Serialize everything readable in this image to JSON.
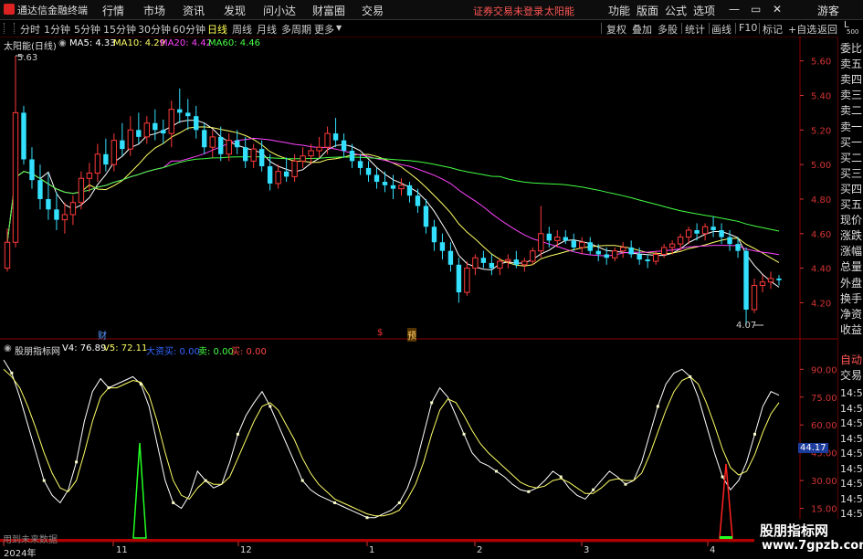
{
  "app": {
    "logo_label": "通达信金融终端",
    "warning": "证券交易未登录",
    "stock_title": "太阳能",
    "guest_label": "游客"
  },
  "menu": {
    "items": [
      "行情",
      "市场",
      "资讯",
      "发现",
      "问小达",
      "财富圈",
      "交易"
    ],
    "right_items": [
      "功能",
      "版面",
      "公式",
      "选项"
    ]
  },
  "toolbar": {
    "periods": [
      "分时",
      "1分钟",
      "5分钟",
      "15分钟",
      "30分钟",
      "60分钟",
      "日线",
      "周线",
      "月线",
      "多周期",
      "更多"
    ],
    "active": "日线",
    "right": [
      "复权",
      "叠加",
      "多股",
      "统计",
      "画线",
      "F10",
      "标记",
      "+自选",
      "返回"
    ]
  },
  "main_chart": {
    "title": "太阳能(日线)",
    "ma": [
      {
        "label": "MA5: 4.33",
        "color": "#ffffff"
      },
      {
        "label": "MA10: 4.29",
        "color": "#ffff66"
      },
      {
        "label": "MA20: 4.42",
        "color": "#ff44ff"
      },
      {
        "label": "MA60: 4.46",
        "color": "#44ff44"
      }
    ],
    "high_label": "5.63",
    "low_label": "4.07",
    "markers": [
      {
        "text": "财",
        "color": "#5599ff"
      },
      {
        "text": "$",
        "color": "#ff3333"
      },
      {
        "text": "预",
        "color": "#ffcc66"
      }
    ]
  },
  "sub_chart": {
    "title": "股朋指标网",
    "v4": "V4: 76.89",
    "v5": "V5: 72.11",
    "big_buy": "大资买: 0.00",
    "sell": "卖: 0.00",
    "buy": "买: 0.00",
    "current_value": "44.17",
    "footer_note": "用到未来数据"
  },
  "side_panel": {
    "corner": [
      "L",
      "500"
    ],
    "top_items": [
      "委比",
      "卖五",
      "卖四",
      "卖三",
      "卖二",
      "卖一",
      "买一",
      "买二",
      "买三",
      "买四",
      "买五",
      "现价",
      "涨跌",
      "涨幅",
      "总量",
      "外盘",
      "换手",
      "净资",
      "收益"
    ],
    "bottom_items": [
      "自动",
      "交易"
    ],
    "times": [
      "14:56",
      "14:56",
      "14:56",
      "14:56",
      "14:56",
      "14:56",
      "14:56",
      "14:56",
      "14:56",
      "14:56"
    ]
  },
  "x_axis": {
    "labels": [
      "2024年",
      "11",
      "12",
      "1",
      "2",
      "3",
      "4"
    ]
  },
  "watermark": {
    "line1": "股朋指标网",
    "line2": "www.7gpzb.com"
  },
  "colors": {
    "up": "#ff3a3a",
    "down": "#33e0ff",
    "axis": "#d33333"
  },
  "chart_data": [
    {
      "type": "candlestick",
      "title": "太阳能(日线)",
      "ylim": [
        4.07,
        5.63
      ],
      "yticks": [
        4.2,
        4.4,
        4.6,
        4.8,
        5.0,
        5.2,
        5.4,
        5.6
      ],
      "ohlc": [
        [
          4.4,
          4.63,
          4.38,
          4.55
        ],
        [
          4.55,
          5.63,
          4.52,
          5.3
        ],
        [
          5.3,
          5.34,
          5.0,
          5.03
        ],
        [
          5.03,
          5.1,
          4.86,
          4.91
        ],
        [
          4.91,
          5.0,
          4.74,
          4.8
        ],
        [
          4.8,
          4.95,
          4.68,
          4.74
        ],
        [
          4.74,
          4.84,
          4.62,
          4.68
        ],
        [
          4.68,
          4.78,
          4.6,
          4.71
        ],
        [
          4.71,
          4.82,
          4.65,
          4.78
        ],
        [
          4.78,
          4.96,
          4.74,
          4.92
        ],
        [
          4.92,
          5.01,
          4.84,
          4.95
        ],
        [
          4.95,
          5.12,
          4.9,
          5.06
        ],
        [
          5.06,
          5.15,
          4.96,
          5.0
        ],
        [
          5.0,
          5.18,
          4.96,
          5.14
        ],
        [
          5.14,
          5.24,
          5.05,
          5.09
        ],
        [
          5.09,
          5.28,
          5.05,
          5.2
        ],
        [
          5.2,
          5.3,
          5.12,
          5.16
        ],
        [
          5.16,
          5.28,
          5.12,
          5.24
        ],
        [
          5.24,
          5.32,
          5.14,
          5.2
        ],
        [
          5.2,
          5.26,
          5.12,
          5.18
        ],
        [
          5.18,
          5.37,
          5.1,
          5.32
        ],
        [
          5.32,
          5.44,
          5.24,
          5.3
        ],
        [
          5.3,
          5.38,
          5.2,
          5.28
        ],
        [
          5.28,
          5.34,
          5.15,
          5.2
        ],
        [
          5.2,
          5.24,
          5.06,
          5.1
        ],
        [
          5.1,
          5.2,
          5.04,
          5.16
        ],
        [
          5.16,
          5.22,
          5.02,
          5.06
        ],
        [
          5.06,
          5.18,
          5.02,
          5.14
        ],
        [
          5.14,
          5.2,
          5.06,
          5.1
        ],
        [
          5.1,
          5.16,
          4.98,
          5.02
        ],
        [
          5.02,
          5.12,
          4.98,
          5.09
        ],
        [
          5.09,
          5.14,
          4.96,
          4.99
        ],
        [
          4.99,
          5.06,
          4.85,
          4.89
        ],
        [
          4.89,
          5.0,
          4.86,
          4.96
        ],
        [
          4.96,
          5.04,
          4.9,
          4.93
        ],
        [
          4.93,
          5.06,
          4.9,
          5.02
        ],
        [
          5.02,
          5.1,
          4.98,
          5.05
        ],
        [
          5.05,
          5.12,
          5.0,
          5.08
        ],
        [
          5.08,
          5.16,
          5.04,
          5.1
        ],
        [
          5.1,
          5.22,
          5.06,
          5.18
        ],
        [
          5.18,
          5.27,
          5.1,
          5.14
        ],
        [
          5.14,
          5.18,
          5.04,
          5.08
        ],
        [
          5.08,
          5.12,
          4.98,
          5.02
        ],
        [
          5.02,
          5.06,
          4.94,
          4.98
        ],
        [
          4.98,
          5.02,
          4.9,
          4.94
        ],
        [
          4.94,
          4.98,
          4.86,
          4.9
        ],
        [
          4.9,
          4.96,
          4.84,
          4.88
        ],
        [
          4.88,
          4.94,
          4.8,
          4.86
        ],
        [
          4.86,
          4.92,
          4.82,
          4.88
        ],
        [
          4.88,
          4.9,
          4.78,
          4.82
        ],
        [
          4.82,
          4.86,
          4.72,
          4.76
        ],
        [
          4.76,
          4.8,
          4.6,
          4.64
        ],
        [
          4.64,
          4.68,
          4.5,
          4.55
        ],
        [
          4.55,
          4.6,
          4.45,
          4.5
        ],
        [
          4.5,
          4.55,
          4.38,
          4.42
        ],
        [
          4.42,
          4.46,
          4.2,
          4.26
        ],
        [
          4.26,
          4.44,
          4.24,
          4.4
        ],
        [
          4.4,
          4.48,
          4.36,
          4.46
        ],
        [
          4.46,
          4.5,
          4.4,
          4.43
        ],
        [
          4.43,
          4.48,
          4.36,
          4.4
        ],
        [
          4.4,
          4.46,
          4.36,
          4.44
        ],
        [
          4.44,
          4.48,
          4.4,
          4.45
        ],
        [
          4.45,
          4.5,
          4.4,
          4.42
        ],
        [
          4.42,
          4.46,
          4.38,
          4.44
        ],
        [
          4.44,
          4.52,
          4.42,
          4.5
        ],
        [
          4.5,
          4.76,
          4.46,
          4.6
        ],
        [
          4.6,
          4.64,
          4.52,
          4.56
        ],
        [
          4.56,
          4.62,
          4.52,
          4.58
        ],
        [
          4.58,
          4.62,
          4.54,
          4.56
        ],
        [
          4.56,
          4.6,
          4.5,
          4.52
        ],
        [
          4.52,
          4.58,
          4.48,
          4.55
        ],
        [
          4.55,
          4.58,
          4.48,
          4.5
        ],
        [
          4.5,
          4.54,
          4.44,
          4.48
        ],
        [
          4.48,
          4.52,
          4.42,
          4.46
        ],
        [
          4.46,
          4.52,
          4.44,
          4.5
        ],
        [
          4.5,
          4.55,
          4.46,
          4.52
        ],
        [
          4.52,
          4.56,
          4.46,
          4.48
        ],
        [
          4.48,
          4.52,
          4.42,
          4.45
        ],
        [
          4.45,
          4.48,
          4.4,
          4.44
        ],
        [
          4.44,
          4.5,
          4.42,
          4.48
        ],
        [
          4.48,
          4.54,
          4.46,
          4.52
        ],
        [
          4.52,
          4.56,
          4.48,
          4.54
        ],
        [
          4.54,
          4.6,
          4.5,
          4.58
        ],
        [
          4.58,
          4.64,
          4.54,
          4.62
        ],
        [
          4.62,
          4.66,
          4.56,
          4.6
        ],
        [
          4.6,
          4.66,
          4.56,
          4.64
        ],
        [
          4.64,
          4.7,
          4.58,
          4.62
        ],
        [
          4.62,
          4.66,
          4.54,
          4.58
        ],
        [
          4.58,
          4.62,
          4.5,
          4.54
        ],
        [
          4.54,
          4.58,
          4.46,
          4.5
        ],
        [
          4.5,
          4.52,
          4.07,
          4.16
        ],
        [
          4.16,
          4.34,
          4.14,
          4.3
        ],
        [
          4.3,
          4.36,
          4.26,
          4.32
        ],
        [
          4.32,
          4.38,
          4.28,
          4.34
        ],
        [
          4.34,
          4.36,
          4.3,
          4.33
        ]
      ]
    },
    {
      "type": "line",
      "title": "股朋指标网",
      "ylim": [
        0,
        100
      ],
      "yticks": [
        15,
        30,
        45,
        60,
        75,
        90
      ],
      "series": [
        {
          "name": "V4",
          "color": "#ffffff",
          "values": [
            95,
            88,
            75,
            60,
            45,
            30,
            22,
            18,
            25,
            40,
            62,
            78,
            85,
            80,
            82,
            84,
            86,
            82,
            70,
            50,
            30,
            18,
            15,
            22,
            35,
            30,
            26,
            28,
            40,
            55,
            65,
            72,
            78,
            70,
            60,
            50,
            40,
            30,
            25,
            22,
            20,
            18,
            16,
            14,
            12,
            10,
            10,
            12,
            14,
            18,
            26,
            38,
            55,
            72,
            80,
            75,
            65,
            55,
            45,
            40,
            38,
            35,
            32,
            28,
            25,
            24,
            26,
            30,
            35,
            32,
            26,
            22,
            20,
            25,
            30,
            35,
            32,
            28,
            30,
            40,
            55,
            70,
            82,
            88,
            90,
            86,
            75,
            60,
            45,
            32,
            25,
            30,
            40,
            55,
            70,
            78,
            76
          ]
        },
        {
          "name": "V5",
          "color": "#ffff66",
          "values": [
            90,
            86,
            80,
            70,
            58,
            45,
            34,
            26,
            24,
            30,
            45,
            62,
            75,
            80,
            80,
            82,
            84,
            83,
            76,
            62,
            45,
            30,
            22,
            20,
            26,
            30,
            28,
            28,
            32,
            42,
            52,
            62,
            70,
            72,
            68,
            60,
            52,
            42,
            34,
            28,
            24,
            20,
            18,
            16,
            14,
            12,
            11,
            11,
            12,
            14,
            20,
            28,
            40,
            55,
            68,
            74,
            72,
            65,
            57,
            50,
            45,
            41,
            37,
            33,
            29,
            27,
            26,
            27,
            30,
            31,
            29,
            26,
            23,
            23,
            26,
            30,
            31,
            30,
            30,
            34,
            44,
            56,
            68,
            78,
            84,
            86,
            82,
            72,
            60,
            47,
            37,
            33,
            35,
            44,
            56,
            66,
            72
          ]
        }
      ]
    }
  ]
}
